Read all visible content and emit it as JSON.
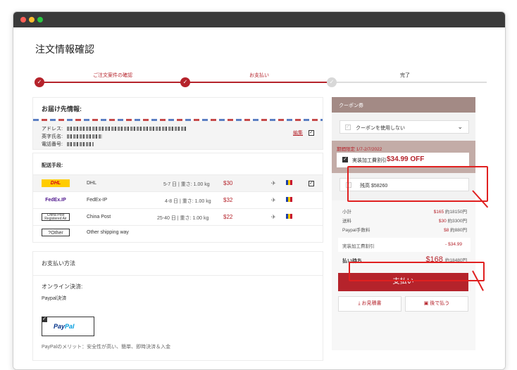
{
  "page_title": "注文情報確認",
  "steps": [
    {
      "label": "ご注文案件の確認"
    },
    {
      "label": "お支払い"
    },
    {
      "label": "完了"
    }
  ],
  "address": {
    "heading": "お届け先情報:",
    "address_label": "アドレス:",
    "name_label": "英字氏名:",
    "phone_label": "電話番号:",
    "edit_link": "編集"
  },
  "shipping": {
    "heading": "配送手段:",
    "options": [
      {
        "logo": "DHL",
        "name": "DHL",
        "time": "5-7 日 | 重さ: 1.00 kg",
        "price": "$30",
        "selected": true
      },
      {
        "logo": "FedEx.IP",
        "name": "FedEx-IP",
        "time": "4-8 日 | 重さ: 1.00 kg",
        "price": "$32",
        "selected": false
      },
      {
        "logo": "China Post Registered Air",
        "name": "China Post",
        "time": "25-40 日 | 重さ: 1.00 kg",
        "price": "$22",
        "selected": false
      },
      {
        "logo": "?Other",
        "name": "Other shipping way",
        "time": "",
        "price": "",
        "selected": false
      }
    ]
  },
  "payment": {
    "heading": "お支払い方法",
    "online_label": "オンライン決済:",
    "paypal_label": "Paypal決済",
    "paypal_logo_a": "Pay",
    "paypal_logo_b": "Pal",
    "paypal_note": "PayPalのメリット：安全性が高い、簡単、即時決済＆入金"
  },
  "coupon": {
    "heading": "クーポン券",
    "select_value": "クーポンを使用しない",
    "promo_date": "期間限定 1/7-2/7/2022",
    "promo_label": "実装加工費割引",
    "promo_amount": "$34.99 OFF",
    "balance_label": "残高 $58260"
  },
  "summary": {
    "subtotal_label": "小計",
    "subtotal_usd": "$165",
    "subtotal_jpy": "約18150円",
    "shipping_label": "送料",
    "shipping_usd": "$30",
    "shipping_jpy": "約3300円",
    "fee_label": "Paypal手数料",
    "fee_usd": "$8",
    "fee_jpy": "約880円",
    "discount_label": "実装加工費割引",
    "discount_value": "- $34.99",
    "total_label": "払い待ち",
    "total_usd": "$168",
    "total_jpy": "約18480円",
    "pay_button": "支払い",
    "quote_button": "お見積書",
    "later_button": "後で払う"
  }
}
